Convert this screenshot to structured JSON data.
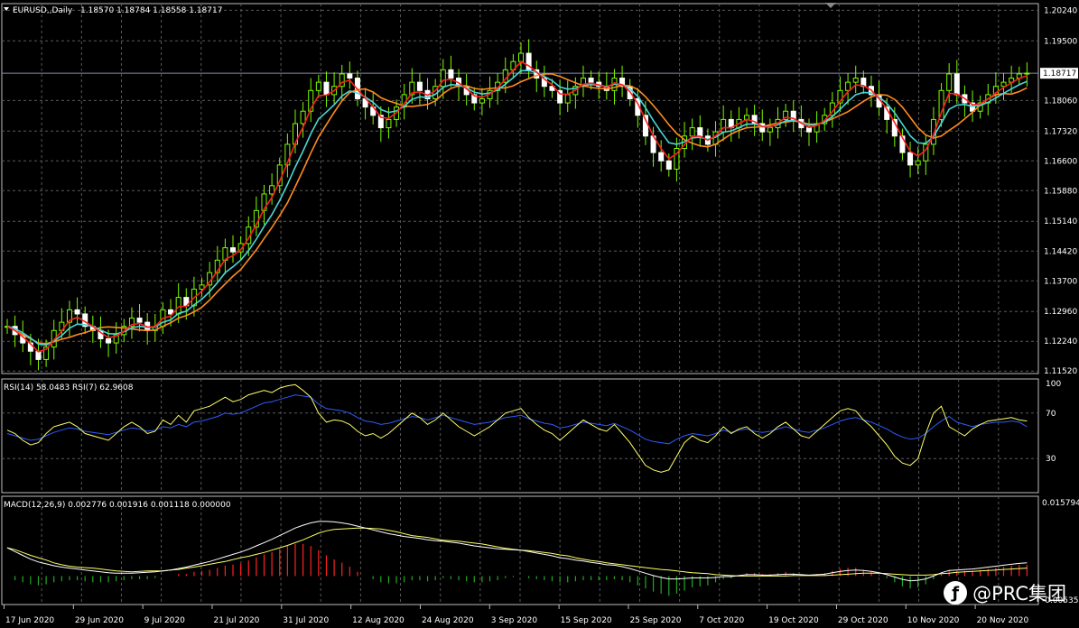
{
  "header": {
    "symbol": "EURUSD,,Daily",
    "ohlc": "1.18570 1.18784 1.18558 1.18717",
    "rsi_label": "RSI(14) 58.0483  RSI(7) 62.9608",
    "macd_label": "MACD(12,26,9) 0.002776 0.001916 0.001118 0.000000"
  },
  "watermark": {
    "text": "@PRC集团"
  },
  "colors": {
    "background": "#000000",
    "grid": "#5a5a5a",
    "bull": "#7CFC00",
    "ma_fast": "#ff1e1e",
    "ma_mid": "#49d7d7",
    "ma_slow": "#ff8c1e",
    "rsi14": "#2d5bff",
    "rsi7": "#ffff66",
    "macd_line": "#ffffff",
    "macd_signal": "#ffff66",
    "hist_pos": "#ff2222",
    "hist_neg": "#22aa22"
  },
  "chart_data": [
    {
      "type": "candlestick",
      "panel": "price",
      "y_ticks": [
        1.2024,
        1.195,
        1.18717,
        1.1806,
        1.1732,
        1.166,
        1.1588,
        1.1514,
        1.1442,
        1.137,
        1.1296,
        1.1224,
        1.1152
      ],
      "y_tick_labels": [
        "1.20240",
        "1.19500",
        "1.18717",
        "1.18060",
        "1.17320",
        "1.16600",
        "1.15880",
        "1.15140",
        "1.14420",
        "1.13700",
        "1.12960",
        "1.12240",
        "1.11520"
      ],
      "current_price": 1.18717,
      "ylim": [
        1.1146,
        1.204
      ],
      "x_labels": [
        "17 Jun 2020",
        "29 Jun 2020",
        "9 Jul 2020",
        "21 Jul 2020",
        "31 Jul 2020",
        "12 Aug 2020",
        "24 Aug 2020",
        "3 Sep 2020",
        "15 Sep 2020",
        "25 Sep 2020",
        "7 Oct 2020",
        "19 Oct 2020",
        "29 Oct 2020",
        "10 Nov 2020",
        "20 Nov 2020"
      ],
      "close": [
        1.126,
        1.124,
        1.122,
        1.12,
        1.118,
        1.121,
        1.125,
        1.127,
        1.13,
        1.129,
        1.126,
        1.125,
        1.123,
        1.122,
        1.124,
        1.126,
        1.128,
        1.127,
        1.125,
        1.126,
        1.13,
        1.129,
        1.133,
        1.131,
        1.135,
        1.136,
        1.139,
        1.142,
        1.145,
        1.144,
        1.146,
        1.15,
        1.154,
        1.158,
        1.16,
        1.165,
        1.17,
        1.175,
        1.178,
        1.183,
        1.185,
        1.182,
        1.184,
        1.187,
        1.186,
        1.181,
        1.179,
        1.177,
        1.174,
        1.176,
        1.179,
        1.182,
        1.185,
        1.183,
        1.181,
        1.184,
        1.188,
        1.186,
        1.184,
        1.182,
        1.18,
        1.181,
        1.183,
        1.185,
        1.188,
        1.19,
        1.192,
        1.188,
        1.186,
        1.184,
        1.183,
        1.18,
        1.182,
        1.184,
        1.186,
        1.185,
        1.184,
        1.183,
        1.186,
        1.184,
        1.181,
        1.177,
        1.172,
        1.168,
        1.166,
        1.164,
        1.169,
        1.172,
        1.174,
        1.172,
        1.17,
        1.173,
        1.176,
        1.174,
        1.176,
        1.177,
        1.175,
        1.173,
        1.174,
        1.176,
        1.178,
        1.176,
        1.174,
        1.173,
        1.175,
        1.177,
        1.18,
        1.183,
        1.185,
        1.186,
        1.184,
        1.182,
        1.179,
        1.176,
        1.172,
        1.168,
        1.165,
        1.166,
        1.17,
        1.176,
        1.183,
        1.187,
        1.182,
        1.18,
        1.178,
        1.18,
        1.182,
        1.184,
        1.185,
        1.186,
        1.187,
        1.1872
      ]
    },
    {
      "type": "line",
      "panel": "rsi",
      "y_ticks": [
        100,
        70,
        30
      ],
      "ylim": [
        0,
        100
      ],
      "series": [
        {
          "name": "RSI(14)",
          "values": [
            52,
            50,
            48,
            46,
            47,
            50,
            53,
            55,
            57,
            56,
            54,
            53,
            52,
            51,
            53,
            55,
            57,
            56,
            54,
            55,
            58,
            57,
            60,
            58,
            62,
            63,
            65,
            67,
            70,
            69,
            70,
            73,
            76,
            79,
            80,
            82,
            84,
            86,
            85,
            84,
            78,
            74,
            73,
            72,
            70,
            66,
            63,
            62,
            60,
            61,
            63,
            65,
            67,
            66,
            64,
            66,
            68,
            66,
            64,
            62,
            60,
            61,
            62,
            64,
            66,
            67,
            68,
            65,
            63,
            61,
            60,
            57,
            58,
            60,
            62,
            61,
            60,
            59,
            61,
            58,
            55,
            51,
            47,
            45,
            44,
            43,
            47,
            50,
            52,
            51,
            50,
            52,
            55,
            53,
            55,
            56,
            54,
            53,
            54,
            56,
            58,
            56,
            54,
            53,
            55,
            57,
            60,
            63,
            65,
            66,
            64,
            62,
            59,
            56,
            52,
            49,
            47,
            48,
            52,
            58,
            63,
            67,
            62,
            60,
            58,
            60,
            61,
            62,
            62,
            63,
            62,
            58
          ]
        },
        {
          "name": "RSI(7)",
          "values": [
            55,
            52,
            46,
            42,
            44,
            52,
            58,
            60,
            62,
            58,
            52,
            50,
            48,
            46,
            52,
            58,
            62,
            58,
            52,
            54,
            64,
            60,
            68,
            62,
            72,
            74,
            76,
            80,
            84,
            80,
            82,
            86,
            88,
            90,
            88,
            92,
            94,
            95,
            90,
            84,
            70,
            62,
            64,
            63,
            60,
            54,
            50,
            52,
            48,
            52,
            58,
            64,
            70,
            66,
            60,
            64,
            70,
            64,
            58,
            54,
            50,
            54,
            58,
            64,
            70,
            72,
            74,
            66,
            60,
            55,
            52,
            46,
            52,
            58,
            64,
            60,
            56,
            54,
            60,
            52,
            44,
            34,
            24,
            20,
            18,
            20,
            32,
            44,
            50,
            46,
            44,
            50,
            58,
            52,
            56,
            58,
            52,
            48,
            52,
            58,
            62,
            56,
            50,
            48,
            54,
            60,
            66,
            72,
            74,
            72,
            64,
            58,
            50,
            42,
            32,
            26,
            24,
            30,
            52,
            70,
            76,
            58,
            54,
            50,
            56,
            60,
            63,
            64,
            65,
            66,
            64,
            63
          ]
        }
      ]
    },
    {
      "type": "bar+line",
      "panel": "macd",
      "y_tick_labels": [
        "0.015794",
        "-0.005355"
      ],
      "ylim": [
        -0.005355,
        0.015794
      ],
      "histogram": [
        0.0,
        -0.0004,
        -0.0006,
        -0.0008,
        -0.0009,
        -0.0008,
        -0.0006,
        -0.0005,
        -0.0004,
        -0.0004,
        -0.0005,
        -0.0006,
        -0.0006,
        -0.0006,
        -0.0005,
        -0.0004,
        -0.0003,
        -0.0003,
        -0.0003,
        -0.0002,
        0.0,
        0.0,
        0.0002,
        0.0002,
        0.0004,
        0.0005,
        0.0006,
        0.0008,
        0.001,
        0.0011,
        0.0012,
        0.0015,
        0.0018,
        0.0021,
        0.0023,
        0.0026,
        0.0029,
        0.0031,
        0.0031,
        0.0029,
        0.0025,
        0.002,
        0.0016,
        0.0013,
        0.0009,
        0.0004,
        0.0,
        -0.0003,
        -0.0006,
        -0.0007,
        -0.0007,
        -0.0006,
        -0.0004,
        -0.0004,
        -0.0005,
        -0.0004,
        -0.0002,
        -0.0003,
        -0.0004,
        -0.0005,
        -0.0006,
        -0.0006,
        -0.0005,
        -0.0004,
        -0.0002,
        -0.0001,
        0.0,
        -0.0002,
        -0.0003,
        -0.0004,
        -0.0005,
        -0.0006,
        -0.0006,
        -0.0005,
        -0.0004,
        -0.0004,
        -0.0004,
        -0.0004,
        -0.0003,
        -0.0004,
        -0.0006,
        -0.0009,
        -0.0012,
        -0.0015,
        -0.0017,
        -0.0019,
        -0.0017,
        -0.0014,
        -0.0011,
        -0.001,
        -0.0009,
        -0.0006,
        -0.0003,
        -0.0002,
        0.0001,
        0.0003,
        0.0003,
        0.0002,
        0.0002,
        0.0003,
        0.0004,
        0.0003,
        0.0002,
        0.0001,
        0.0002,
        0.0003,
        0.0005,
        0.0007,
        0.0008,
        0.0008,
        0.0006,
        0.0004,
        0.0001,
        -0.0002,
        -0.0006,
        -0.001,
        -0.0012,
        -0.0011,
        -0.0008,
        -0.0003,
        0.0002,
        0.0006,
        0.0005,
        0.0005,
        0.0005,
        0.0006,
        0.0007,
        0.0008,
        0.0009,
        0.001,
        0.0011,
        0.0011
      ],
      "series": [
        {
          "name": "MACD",
          "values": [
            0.006,
            0.0052,
            0.0044,
            0.0036,
            0.003,
            0.0026,
            0.0022,
            0.0019,
            0.0017,
            0.0015,
            0.0013,
            0.0011,
            0.0009,
            0.0007,
            0.0006,
            0.0006,
            0.0006,
            0.0007,
            0.0008,
            0.0009,
            0.0011,
            0.0013,
            0.0016,
            0.0019,
            0.0023,
            0.0027,
            0.0031,
            0.0036,
            0.0041,
            0.0046,
            0.0051,
            0.0057,
            0.0064,
            0.0071,
            0.0078,
            0.0086,
            0.0094,
            0.0102,
            0.0108,
            0.0113,
            0.0116,
            0.0116,
            0.0115,
            0.0113,
            0.011,
            0.0106,
            0.0102,
            0.0098,
            0.0094,
            0.009,
            0.0087,
            0.0084,
            0.0082,
            0.008,
            0.0077,
            0.0075,
            0.0074,
            0.0072,
            0.007,
            0.0067,
            0.0064,
            0.0062,
            0.006,
            0.0058,
            0.0057,
            0.0056,
            0.0055,
            0.0052,
            0.0049,
            0.0046,
            0.0043,
            0.0039,
            0.0037,
            0.0034,
            0.0032,
            0.0029,
            0.0027,
            0.0024,
            0.0023,
            0.002,
            0.0016,
            0.0011,
            0.0006,
            0.0001,
            -0.0003,
            -0.0006,
            -0.0006,
            -0.0005,
            -0.0004,
            -0.0004,
            -0.0004,
            -0.0003,
            -0.0001,
            -0.0001,
            0.0001,
            0.0003,
            0.0003,
            0.0002,
            0.0002,
            0.0003,
            0.0004,
            0.0004,
            0.0003,
            0.0002,
            0.0003,
            0.0004,
            0.0007,
            0.001,
            0.0012,
            0.0013,
            0.0012,
            0.001,
            0.0007,
            0.0003,
            -0.0002,
            -0.0007,
            -0.001,
            -0.0009,
            -0.0006,
            0.0,
            0.0007,
            0.0012,
            0.0013,
            0.0014,
            0.0015,
            0.0017,
            0.0019,
            0.0021,
            0.0023,
            0.0025,
            0.0027,
            0.0028
          ]
        },
        {
          "name": "Signal",
          "values": [
            0.006,
            0.0056,
            0.005,
            0.0044,
            0.0039,
            0.0034,
            0.0028,
            0.0024,
            0.0021,
            0.0019,
            0.0018,
            0.0017,
            0.0015,
            0.0013,
            0.0011,
            0.001,
            0.0009,
            0.001,
            0.0011,
            0.0011,
            0.0011,
            0.0013,
            0.0014,
            0.0017,
            0.0019,
            0.0022,
            0.0025,
            0.0028,
            0.0031,
            0.0035,
            0.0039,
            0.0042,
            0.0046,
            0.005,
            0.0055,
            0.006,
            0.0065,
            0.0071,
            0.0077,
            0.0084,
            0.0091,
            0.0096,
            0.0099,
            0.01,
            0.0101,
            0.0102,
            0.0102,
            0.0101,
            0.01,
            0.0097,
            0.0094,
            0.009,
            0.0086,
            0.0084,
            0.0082,
            0.0079,
            0.0076,
            0.0075,
            0.0074,
            0.0072,
            0.007,
            0.0068,
            0.0065,
            0.0062,
            0.0059,
            0.0057,
            0.0055,
            0.0054,
            0.0052,
            0.005,
            0.0048,
            0.0045,
            0.0043,
            0.0039,
            0.0036,
            0.0033,
            0.0031,
            0.0028,
            0.0026,
            0.0024,
            0.0022,
            0.002,
            0.0018,
            0.0016,
            0.0014,
            0.0013,
            0.0011,
            0.0009,
            0.0007,
            0.0006,
            0.0005,
            0.0003,
            0.0002,
            0.0001,
            0.0,
            0.0,
            0.0,
            0.0,
            0.0,
            0.0,
            0.0,
            0.0001,
            0.0001,
            0.0001,
            0.0001,
            0.0001,
            0.0002,
            0.0003,
            0.0004,
            0.0005,
            0.0006,
            0.0006,
            0.0006,
            0.0005,
            0.0004,
            0.0003,
            0.0002,
            0.0002,
            0.0002,
            0.0003,
            0.0005,
            0.0006,
            0.0008,
            0.0009,
            0.001,
            0.0011,
            0.0012,
            0.0013,
            0.0014,
            0.0015,
            0.0016,
            0.0017
          ]
        }
      ]
    }
  ]
}
